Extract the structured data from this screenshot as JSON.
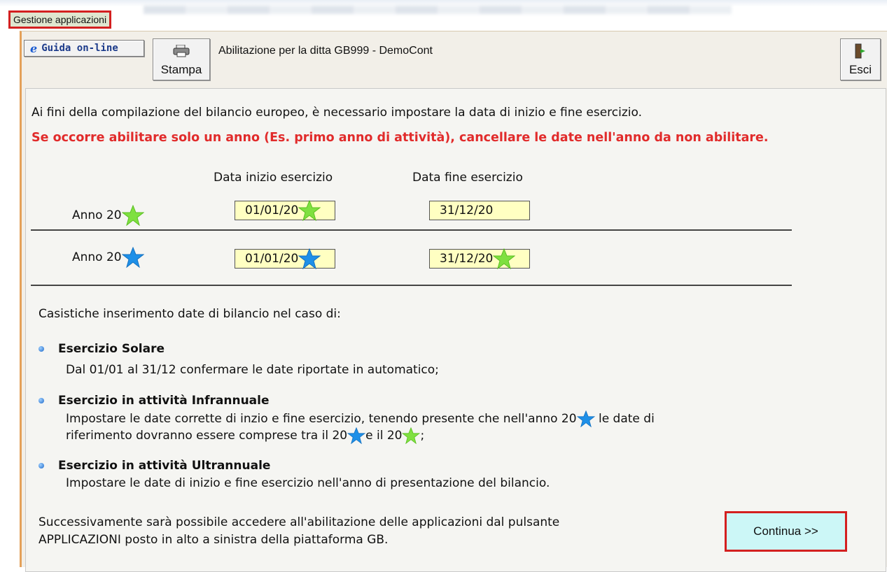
{
  "window": {
    "title": "Gestione applicazioni"
  },
  "toolbar": {
    "guida_label": "Guida on-line",
    "stampa_label": "Stampa",
    "esci_label": "Esci",
    "header_text": "Abilitazione per la ditta GB999 -  DemoCont"
  },
  "content": {
    "intro": "Ai fini della compilazione del bilancio europeo, è necessario impostare la data di inizio e fine esercizio.",
    "warning": "Se occorre abilitare solo un anno (Es. primo anno di attività), cancellare le date nell'anno da non abilitare.",
    "col_start": "Data inizio esercizio",
    "col_end": "Data fine esercizio",
    "rows": [
      {
        "label": "Anno 20",
        "label_star": "green",
        "start": "01/01/20",
        "start_star": "green",
        "end": "31/12/20",
        "end_star": ""
      },
      {
        "label": "Anno 20",
        "label_star": "blue",
        "start": "01/01/20",
        "start_star": "blue",
        "end": "31/12/20",
        "end_star": "green"
      }
    ],
    "cases_title": "Casistiche inserimento date di bilancio nel caso di:",
    "case1": {
      "title": "Esercizio Solare",
      "text": "Dal 01/01 al 31/12 confermare le date riportate in automatico;"
    },
    "case2": {
      "title": "Esercizio in attività Infrannuale",
      "text1_a": "Impostare le date corrette di inzio e fine esercizio, tenendo presente che nell'anno 20",
      "text1_b": "le date di",
      "text2_a": "riferimento dovranno essere comprese tra il 20",
      "text2_b": "e il 20",
      "text2_c": ";"
    },
    "case3": {
      "title": "Esercizio in attività Ultrannuale",
      "text": "Impostare le date di inizio e fine esercizio nell'anno di presentazione del bilancio."
    },
    "footer_line1": "Successivamente sarà possibile accedere all'abilitazione delle applicazioni dal pulsante",
    "footer_line2": "APPLICAZIONI posto in alto a sinistra della piattaforma GB.",
    "continue_label": "Continua >>"
  },
  "colors": {
    "warning": "#e12b2b",
    "field_bg": "#ffffc2",
    "continue_bg": "#ccf7f7",
    "highlight_border": "#d32020",
    "star_green": "#7fe040",
    "star_blue": "#1e90e8"
  },
  "icons": [
    "ie-e-icon",
    "printer-icon",
    "door-exit-icon",
    "star-green-icon",
    "star-blue-icon",
    "bullet-icon"
  ]
}
